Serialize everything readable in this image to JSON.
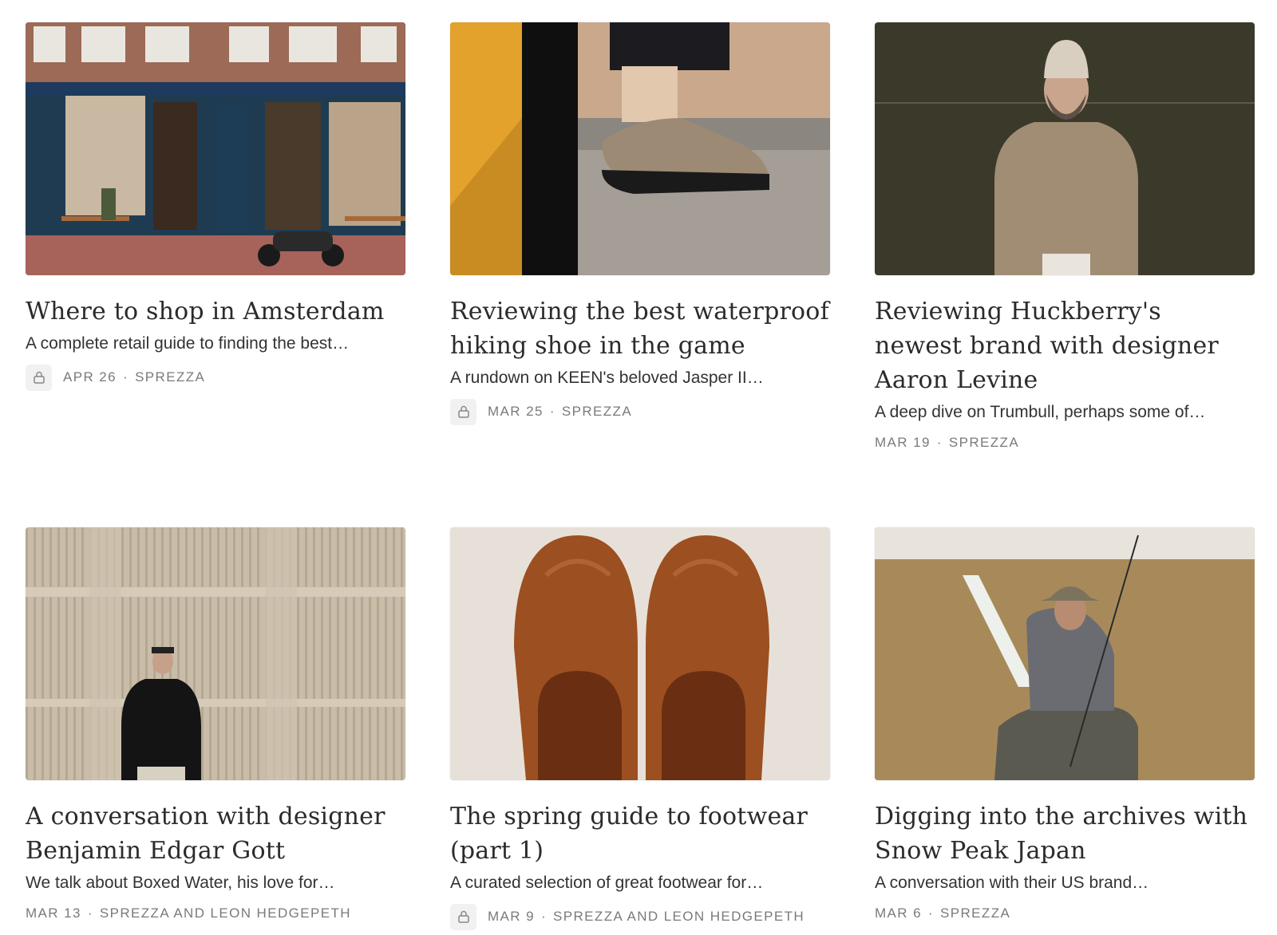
{
  "posts": [
    {
      "title": "Where to shop in Amsterdam",
      "subtitle": "A complete retail guide to finding the best…",
      "date": "APR 26",
      "author": "SPREZZA",
      "locked": true,
      "image": "amsterdam-storefront"
    },
    {
      "title": "Reviewing the best waterproof hiking shoe in the game",
      "subtitle": "A rundown on KEEN's beloved Jasper II…",
      "date": "MAR 25",
      "author": "SPREZZA",
      "locked": true,
      "image": "hiking-shoe-on-step"
    },
    {
      "title": "Reviewing Huckberry's newest brand with designer Aaron Levine",
      "subtitle": "A deep dive on Trumbull, perhaps some of…",
      "date": "MAR 19",
      "author": "SPREZZA",
      "locked": false,
      "image": "man-in-hoodie"
    },
    {
      "title": "A conversation with designer Benjamin Edgar Gott",
      "subtitle": "We talk about Boxed Water, his love for…",
      "date": "MAR 13",
      "author": "SPREZZA AND LEON HEDGEPETH",
      "locked": false,
      "image": "man-against-wall"
    },
    {
      "title": "The spring guide to footwear (part 1)",
      "subtitle": "A curated selection of great footwear for…",
      "date": "MAR 9",
      "author": "SPREZZA AND LEON HEDGEPETH",
      "locked": true,
      "image": "leather-clogs"
    },
    {
      "title": "Digging into the archives with Snow Peak Japan",
      "subtitle": "A conversation with their US brand…",
      "date": "MAR 6",
      "author": "SPREZZA",
      "locked": false,
      "image": "man-in-field"
    }
  ],
  "separator": "·",
  "colors": {
    "text": "#2b2b2b",
    "meta": "#7a7a7a",
    "lock_bg": "#f1f1f1"
  }
}
